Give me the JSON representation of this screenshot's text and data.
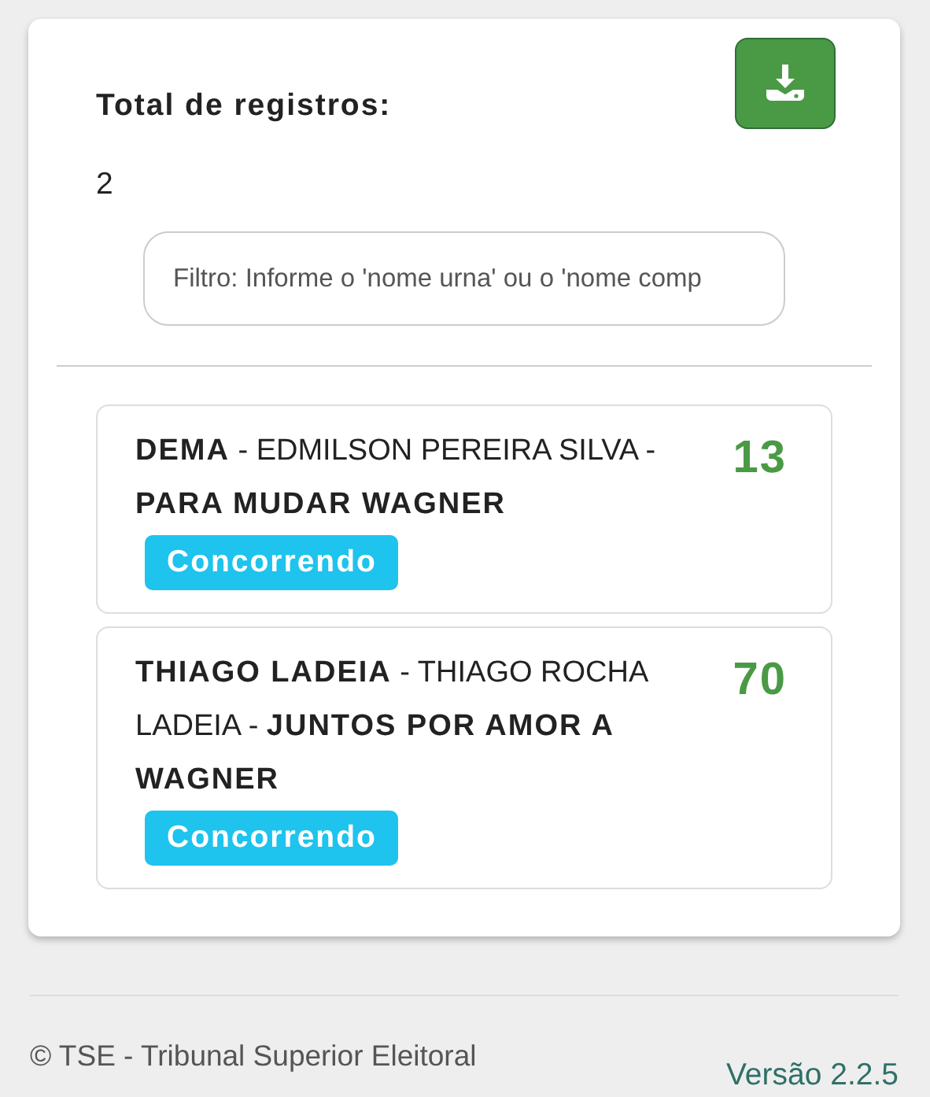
{
  "summary": {
    "label": "Total de registros:",
    "count": "2"
  },
  "filter": {
    "placeholder": "Filtro: Informe o 'nome urna' ou o 'nome comp"
  },
  "candidates": [
    {
      "description": "**DEMA** - EDMILSON PEREIRA SILVA - **PARA MUDAR WAGNER**",
      "number": "13",
      "status": "Concorrendo"
    },
    {
      "description": "**THIAGO LADEIA** - THIAGO ROCHA LADEIA - **JUNTOS POR AMOR A WAGNER**",
      "number": "70",
      "status": "Concorrendo"
    }
  ],
  "footer": {
    "copyright": "© TSE - Tribunal Superior Eleitoral",
    "version": "Versão 2.2.5"
  }
}
